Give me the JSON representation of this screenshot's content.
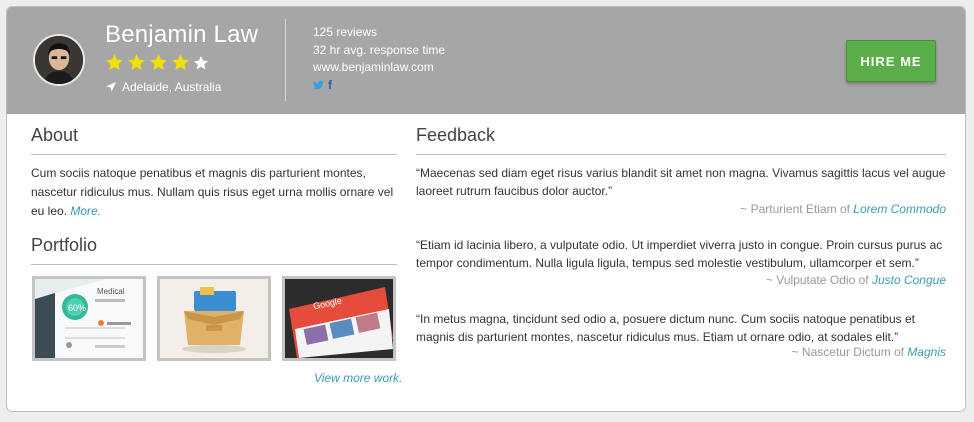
{
  "profile": {
    "name": "Benjamin Law",
    "rating": {
      "value": 4,
      "max": 5
    },
    "location": "Adelaide, Australia",
    "stats": {
      "reviews": "125 reviews",
      "response": "32 hr avg. response time",
      "website": "www.benjaminlaw.com"
    },
    "social": {
      "twitter": "twitter-icon",
      "facebook": "f"
    },
    "hire_label": "HIRE ME"
  },
  "about": {
    "title": "About",
    "text": "Cum sociis natoque penatibus et magnis dis parturient montes, nascetur ridiculus mus. Nullam quis risus eget urna mollis ornare vel eu leo.",
    "more": "More."
  },
  "portfolio": {
    "title": "Portfolio",
    "items": [
      {
        "badge": "60%",
        "caption": "Medical"
      },
      {
        "caption": ""
      },
      {
        "caption": "Google"
      }
    ],
    "view_more": "View more work."
  },
  "feedback": {
    "title": "Feedback",
    "items": [
      {
        "quote": "“Maecenas sed diam eget risus varius blandit sit amet non magna. Vivamus sagittis lacus vel augue laoreet rutrum faucibus dolor auctor.”",
        "author": "~ Parturient Etiam of",
        "company": "Lorem Commodo"
      },
      {
        "quote": "“Etiam id lacinia libero, a vulputate odio. Ut imperdiet viverra justo in congue. Proin cursus purus ac tempor condimentum. Nulla ligula ligula, tempus sed molestie vestibulum, ullamcorper et sem.”",
        "author": "~ Vulputate Odio of",
        "company": "Justo Congue"
      },
      {
        "quote": "“In metus magna, tincidunt sed odio a, posuere dictum nunc. Cum sociis natoque penatibus et magnis dis parturient montes, nascetur ridiculus mus. Etiam ut ornare odio, at sodales elit.”",
        "author": "~ Nascetur Dictum of",
        "company": "Magnis"
      }
    ]
  },
  "colors": {
    "header_bg": "#a6a6a6",
    "hire_button": "#5cae4a",
    "star_filled": "#f2e000",
    "star_empty": "#ffffff",
    "link": "#3a9bb3"
  }
}
